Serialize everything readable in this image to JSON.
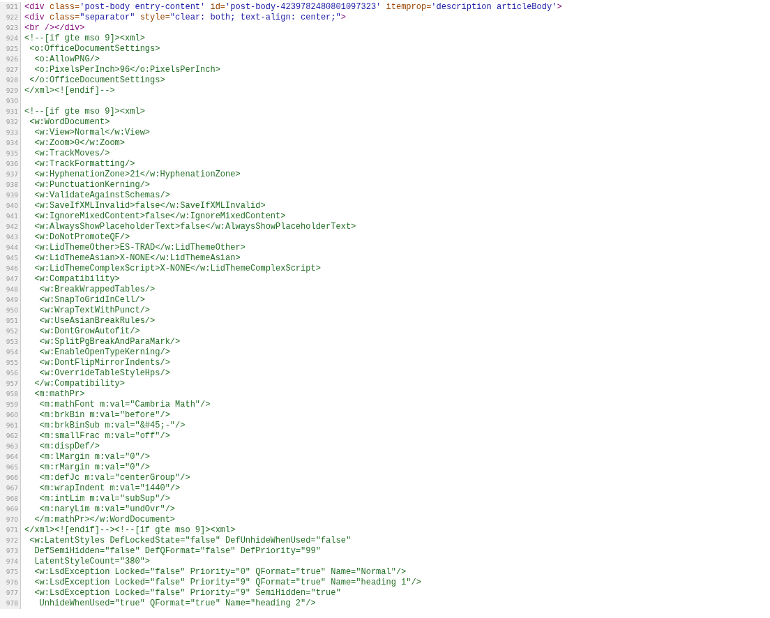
{
  "lines": [
    {
      "number": "921",
      "segments": [
        {
          "kind": "tag",
          "text": "<div"
        },
        {
          "kind": "attr",
          "text": " class="
        },
        {
          "kind": "value",
          "text": "'post-body entry-content'"
        },
        {
          "kind": "attr",
          "text": " id="
        },
        {
          "kind": "value",
          "text": "'post-body-4239782480801097323'"
        },
        {
          "kind": "attr",
          "text": " itemprop="
        },
        {
          "kind": "value",
          "text": "'description articleBody'"
        },
        {
          "kind": "tag",
          "text": ">"
        }
      ]
    },
    {
      "number": "922",
      "segments": [
        {
          "kind": "tag",
          "text": "<div"
        },
        {
          "kind": "attr",
          "text": " class="
        },
        {
          "kind": "value",
          "text": "\"separator\""
        },
        {
          "kind": "attr",
          "text": " style="
        },
        {
          "kind": "value",
          "text": "\"clear: both; text-align: center;\""
        },
        {
          "kind": "tag",
          "text": ">"
        }
      ]
    },
    {
      "number": "923",
      "segments": [
        {
          "kind": "tag",
          "text": "<br />"
        },
        {
          "kind": "tag",
          "text": "</div>"
        }
      ]
    },
    {
      "number": "924",
      "segments": [
        {
          "kind": "comment",
          "text": "<!--[if gte mso 9]><xml>"
        }
      ]
    },
    {
      "number": "925",
      "segments": [
        {
          "kind": "comment",
          "text": " <o:OfficeDocumentSettings>"
        }
      ]
    },
    {
      "number": "926",
      "segments": [
        {
          "kind": "comment",
          "text": "  <o:AllowPNG/>"
        }
      ]
    },
    {
      "number": "927",
      "segments": [
        {
          "kind": "comment",
          "text": "  <o:PixelsPerInch>96</o:PixelsPerInch>"
        }
      ]
    },
    {
      "number": "928",
      "segments": [
        {
          "kind": "comment",
          "text": " </o:OfficeDocumentSettings>"
        }
      ]
    },
    {
      "number": "929",
      "segments": [
        {
          "kind": "comment",
          "text": "</xml><![endif]-->"
        }
      ]
    },
    {
      "number": "930"
    },
    {
      "number": "931",
      "segments": [
        {
          "kind": "comment",
          "text": "<!--[if gte mso 9]><xml>"
        }
      ]
    },
    {
      "number": "932",
      "segments": [
        {
          "kind": "comment",
          "text": " <w:WordDocument>"
        }
      ]
    },
    {
      "number": "933",
      "segments": [
        {
          "kind": "comment",
          "text": "  <w:View>Normal</w:View>"
        }
      ]
    },
    {
      "number": "934",
      "segments": [
        {
          "kind": "comment",
          "text": "  <w:Zoom>0</w:Zoom>"
        }
      ]
    },
    {
      "number": "935",
      "segments": [
        {
          "kind": "comment",
          "text": "  <w:TrackMoves/>"
        }
      ]
    },
    {
      "number": "936",
      "segments": [
        {
          "kind": "comment",
          "text": "  <w:TrackFormatting/>"
        }
      ]
    },
    {
      "number": "937",
      "segments": [
        {
          "kind": "comment",
          "text": "  <w:HyphenationZone>21</w:HyphenationZone>"
        }
      ]
    },
    {
      "number": "938",
      "segments": [
        {
          "kind": "comment",
          "text": "  <w:PunctuationKerning/>"
        }
      ]
    },
    {
      "number": "939",
      "segments": [
        {
          "kind": "comment",
          "text": "  <w:ValidateAgainstSchemas/>"
        }
      ]
    },
    {
      "number": "940",
      "segments": [
        {
          "kind": "comment",
          "text": "  <w:SaveIfXMLInvalid>false</w:SaveIfXMLInvalid>"
        }
      ]
    },
    {
      "number": "941",
      "segments": [
        {
          "kind": "comment",
          "text": "  <w:IgnoreMixedContent>false</w:IgnoreMixedContent>"
        }
      ]
    },
    {
      "number": "942",
      "segments": [
        {
          "kind": "comment",
          "text": "  <w:AlwaysShowPlaceholderText>false</w:AlwaysShowPlaceholderText>"
        }
      ]
    },
    {
      "number": "943",
      "segments": [
        {
          "kind": "comment",
          "text": "  <w:DoNotPromoteQF/>"
        }
      ]
    },
    {
      "number": "944",
      "segments": [
        {
          "kind": "comment",
          "text": "  <w:LidThemeOther>ES-TRAD</w:LidThemeOther>"
        }
      ]
    },
    {
      "number": "945",
      "segments": [
        {
          "kind": "comment",
          "text": "  <w:LidThemeAsian>X-NONE</w:LidThemeAsian>"
        }
      ]
    },
    {
      "number": "946",
      "segments": [
        {
          "kind": "comment",
          "text": "  <w:LidThemeComplexScript>X-NONE</w:LidThemeComplexScript>"
        }
      ]
    },
    {
      "number": "947",
      "segments": [
        {
          "kind": "comment",
          "text": "  <w:Compatibility>"
        }
      ]
    },
    {
      "number": "948",
      "segments": [
        {
          "kind": "comment",
          "text": "   <w:BreakWrappedTables/>"
        }
      ]
    },
    {
      "number": "949",
      "segments": [
        {
          "kind": "comment",
          "text": "   <w:SnapToGridInCell/>"
        }
      ]
    },
    {
      "number": "950",
      "segments": [
        {
          "kind": "comment",
          "text": "   <w:WrapTextWithPunct/>"
        }
      ]
    },
    {
      "number": "951",
      "segments": [
        {
          "kind": "comment",
          "text": "   <w:UseAsianBreakRules/>"
        }
      ]
    },
    {
      "number": "952",
      "segments": [
        {
          "kind": "comment",
          "text": "   <w:DontGrowAutofit/>"
        }
      ]
    },
    {
      "number": "953",
      "segments": [
        {
          "kind": "comment",
          "text": "   <w:SplitPgBreakAndParaMark/>"
        }
      ]
    },
    {
      "number": "954",
      "segments": [
        {
          "kind": "comment",
          "text": "   <w:EnableOpenTypeKerning/>"
        }
      ]
    },
    {
      "number": "955",
      "segments": [
        {
          "kind": "comment",
          "text": "   <w:DontFlipMirrorIndents/>"
        }
      ]
    },
    {
      "number": "956",
      "segments": [
        {
          "kind": "comment",
          "text": "   <w:OverrideTableStyleHps/>"
        }
      ]
    },
    {
      "number": "957",
      "segments": [
        {
          "kind": "comment",
          "text": "  </w:Compatibility>"
        }
      ]
    },
    {
      "number": "958",
      "segments": [
        {
          "kind": "comment",
          "text": "  <m:mathPr>"
        }
      ]
    },
    {
      "number": "959",
      "segments": [
        {
          "kind": "comment",
          "text": "   <m:mathFont m:val=\"Cambria Math\"/>"
        }
      ]
    },
    {
      "number": "960",
      "segments": [
        {
          "kind": "comment",
          "text": "   <m:brkBin m:val=\"before\"/>"
        }
      ]
    },
    {
      "number": "961",
      "segments": [
        {
          "kind": "comment",
          "text": "   <m:brkBinSub m:val=\"&#45;-\"/>"
        }
      ]
    },
    {
      "number": "962",
      "segments": [
        {
          "kind": "comment",
          "text": "   <m:smallFrac m:val=\"off\"/>"
        }
      ]
    },
    {
      "number": "963",
      "segments": [
        {
          "kind": "comment",
          "text": "   <m:dispDef/>"
        }
      ]
    },
    {
      "number": "964",
      "segments": [
        {
          "kind": "comment",
          "text": "   <m:lMargin m:val=\"0\"/>"
        }
      ]
    },
    {
      "number": "965",
      "segments": [
        {
          "kind": "comment",
          "text": "   <m:rMargin m:val=\"0\"/>"
        }
      ]
    },
    {
      "number": "966",
      "segments": [
        {
          "kind": "comment",
          "text": "   <m:defJc m:val=\"centerGroup\"/>"
        }
      ]
    },
    {
      "number": "967",
      "segments": [
        {
          "kind": "comment",
          "text": "   <m:wrapIndent m:val=\"1440\"/>"
        }
      ]
    },
    {
      "number": "968",
      "segments": [
        {
          "kind": "comment",
          "text": "   <m:intLim m:val=\"subSup\"/>"
        }
      ]
    },
    {
      "number": "969",
      "segments": [
        {
          "kind": "comment",
          "text": "   <m:naryLim m:val=\"undOvr\"/>"
        }
      ]
    },
    {
      "number": "970",
      "segments": [
        {
          "kind": "comment",
          "text": "  </m:mathPr></w:WordDocument>"
        }
      ]
    },
    {
      "number": "971",
      "segments": [
        {
          "kind": "comment",
          "text": "</xml><![endif]--><!--[if gte mso 9]><xml>"
        }
      ]
    },
    {
      "number": "972",
      "segments": [
        {
          "kind": "comment",
          "text": " <w:LatentStyles DefLockedState=\"false\" DefUnhideWhenUsed=\"false\""
        }
      ]
    },
    {
      "number": "973",
      "segments": [
        {
          "kind": "comment",
          "text": "  DefSemiHidden=\"false\" DefQFormat=\"false\" DefPriority=\"99\""
        }
      ]
    },
    {
      "number": "974",
      "segments": [
        {
          "kind": "comment",
          "text": "  LatentStyleCount=\"380\">"
        }
      ]
    },
    {
      "number": "975",
      "segments": [
        {
          "kind": "comment",
          "text": "  <w:LsdException Locked=\"false\" Priority=\"0\" QFormat=\"true\" Name=\"Normal\"/>"
        }
      ]
    },
    {
      "number": "976",
      "segments": [
        {
          "kind": "comment",
          "text": "  <w:LsdException Locked=\"false\" Priority=\"9\" QFormat=\"true\" Name=\"heading 1\"/>"
        }
      ]
    },
    {
      "number": "977",
      "segments": [
        {
          "kind": "comment",
          "text": "  <w:LsdException Locked=\"false\" Priority=\"9\" SemiHidden=\"true\""
        }
      ]
    },
    {
      "number": "978",
      "segments": [
        {
          "kind": "comment",
          "text": "   UnhideWhenUsed=\"true\" QFormat=\"true\" Name=\"heading 2\"/>"
        }
      ]
    }
  ]
}
